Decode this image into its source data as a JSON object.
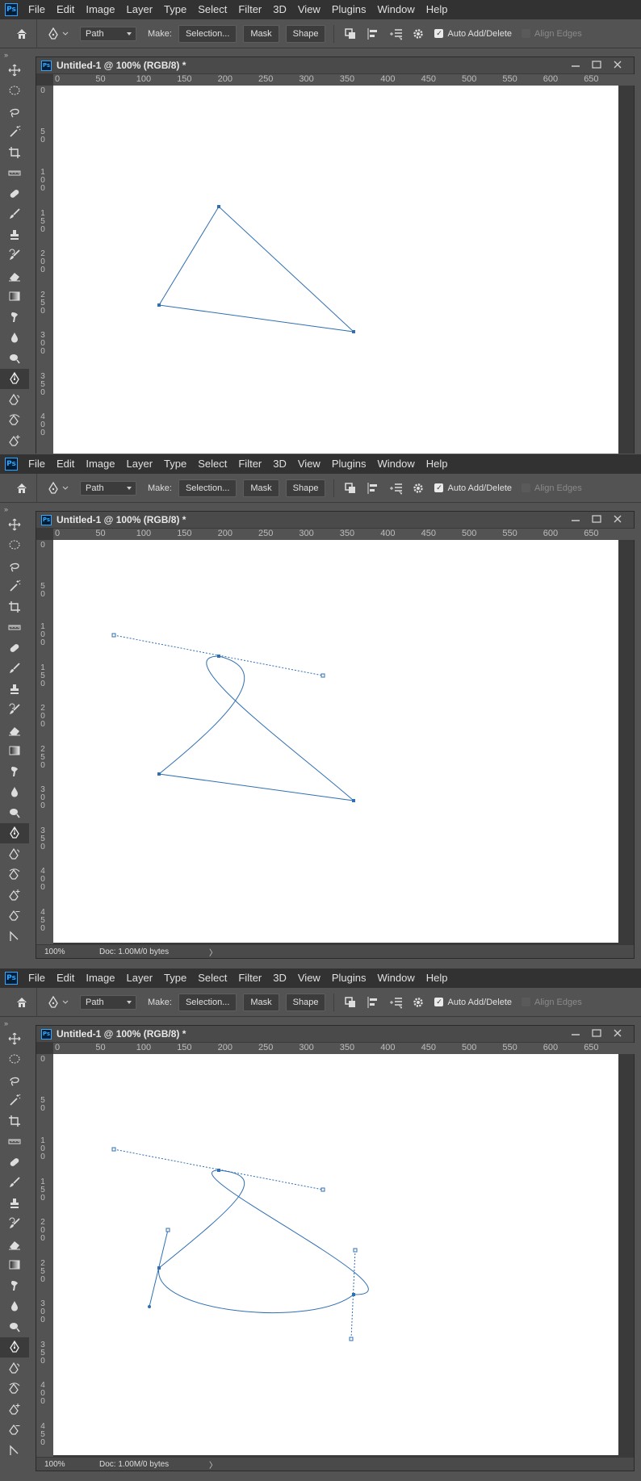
{
  "app": {
    "logo": "Ps",
    "menu": [
      "File",
      "Edit",
      "Image",
      "Layer",
      "Type",
      "Select",
      "Filter",
      "3D",
      "View",
      "Plugins",
      "Window",
      "Help"
    ]
  },
  "options": {
    "mode_select": "Path",
    "make_label": "Make:",
    "selection_btn": "Selection...",
    "mask_btn": "Mask",
    "shape_btn": "Shape",
    "auto_add_delete": "Auto Add/Delete",
    "auto_add_delete_checked": true,
    "align_edges": "Align Edges",
    "align_edges_checked": false
  },
  "document": {
    "ps_badge": "Ps",
    "title": "Untitled-1 @ 100% (RGB/8) *",
    "ruler_ticks": [
      "0",
      "50",
      "100",
      "150",
      "200",
      "250",
      "300",
      "350",
      "400",
      "450",
      "500",
      "550",
      "600",
      "650"
    ],
    "ruler_vertical_labels": [
      "0",
      "5 0",
      "1 0 0",
      "1 5 0",
      "2 0 0",
      "2 5 0",
      "3 0 0",
      "3 5 0",
      "4 0 0",
      "4 5 0"
    ],
    "status_zoom": "100%",
    "status_doc": "Doc: 1.00M/0 bytes",
    "status_arrow": "〉"
  },
  "tools": [
    "move-icon",
    "marquee-icon",
    "lasso-icon",
    "magic-wand-icon",
    "crop-icon",
    "ruler-icon",
    "healing-brush-icon",
    "brush-icon",
    "clone-stamp-icon",
    "history-brush-icon",
    "eraser-icon",
    "gradient-icon",
    "smudge-icon",
    "blur-drop-icon",
    "dodge-icon",
    "pen-icon",
    "freeform-pen-icon",
    "curvature-pen-icon",
    "add-anchor-icon",
    "delete-anchor-icon",
    "convert-point-icon"
  ],
  "colors": {
    "path": "#2f6fb3",
    "chrome_dark": "#323232",
    "chrome": "#535353",
    "canvas": "#ffffff"
  }
}
